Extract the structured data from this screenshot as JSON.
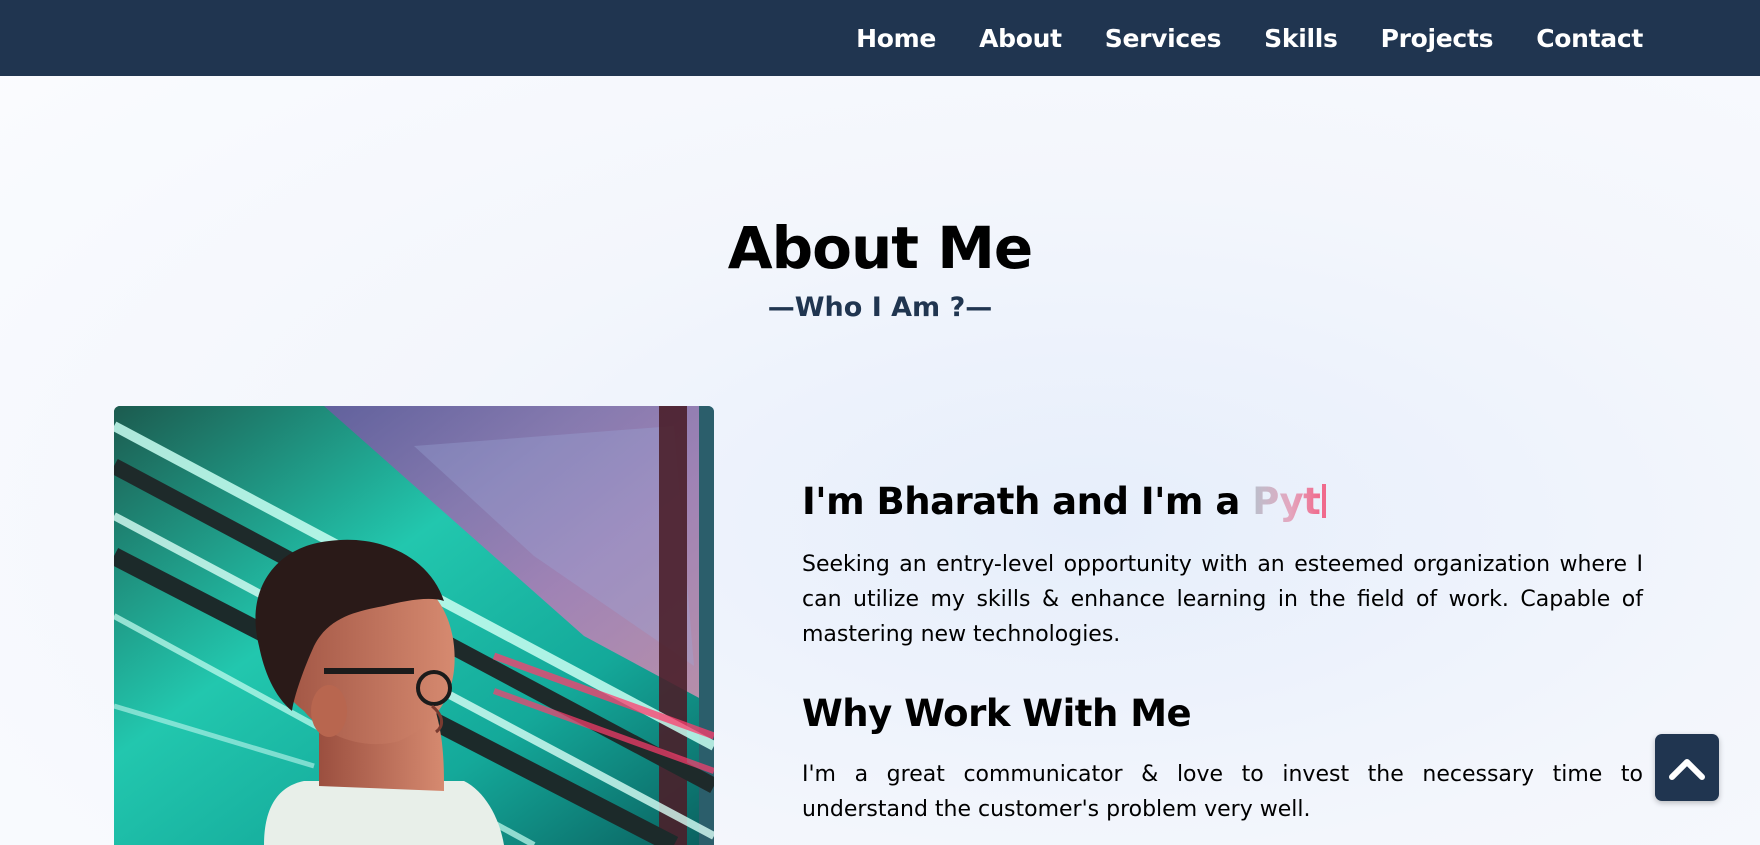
{
  "nav": {
    "items": [
      {
        "label": "Home"
      },
      {
        "label": "About"
      },
      {
        "label": "Services"
      },
      {
        "label": "Skills"
      },
      {
        "label": "Projects"
      },
      {
        "label": "Contact"
      }
    ]
  },
  "about": {
    "title": "About Me",
    "subtitle": "—Who I Am ?—",
    "greeting": "I'm Bharath and I'm a ",
    "typed_text": "Pyt",
    "intro": "Seeking an entry-level opportunity with an esteemed organization where I can utilize my skills & enhance learning in the field of work. Capable of mastering new technologies.",
    "why_title": "Why Work With Me",
    "why_text": "I'm a great communicator & love to invest the necessary time to understand the customer's problem very well."
  },
  "icons": {
    "scroll_top": "chevron-up-icon",
    "photo": "profile-photo"
  },
  "colors": {
    "navbar": "#203550",
    "accent": "#203550",
    "typed_gradient_end": "#f06a8c"
  }
}
